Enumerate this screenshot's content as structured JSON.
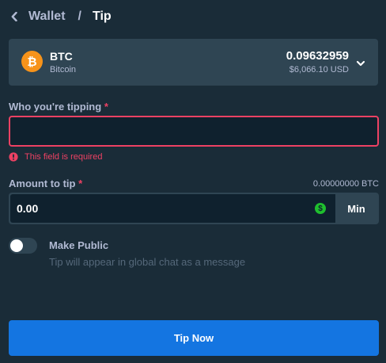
{
  "header": {
    "back_icon": "chevron-left-icon",
    "crumbs": [
      "Wallet",
      "Tip"
    ],
    "separator": "/"
  },
  "currency": {
    "icon": "bitcoin-icon",
    "code": "BTC",
    "name": "Bitcoin",
    "balance": "0.09632959",
    "fiat": "$6,066.10 USD",
    "dropdown_icon": "chevron-down-icon"
  },
  "recipient": {
    "label": "Who you're tipping",
    "required_mark": "*",
    "value": "",
    "error_icon": "alert-icon",
    "error": "This field is required"
  },
  "amount": {
    "label": "Amount to tip",
    "required_mark": "*",
    "converted": "0.00000000 BTC",
    "value": "0.00",
    "currency_icon": "dollar-icon",
    "min_label": "Min"
  },
  "public_toggle": {
    "enabled": false,
    "title": "Make Public",
    "description": "Tip will appear in global chat as a message"
  },
  "submit": {
    "label": "Tip Now"
  },
  "colors": {
    "background": "#1a2c38",
    "panel": "#2f4553",
    "input": "#0f212e",
    "error": "#ed4163",
    "primary": "#1475e1",
    "bitcoin": "#f7931a",
    "usd": "#1fbf2e"
  }
}
